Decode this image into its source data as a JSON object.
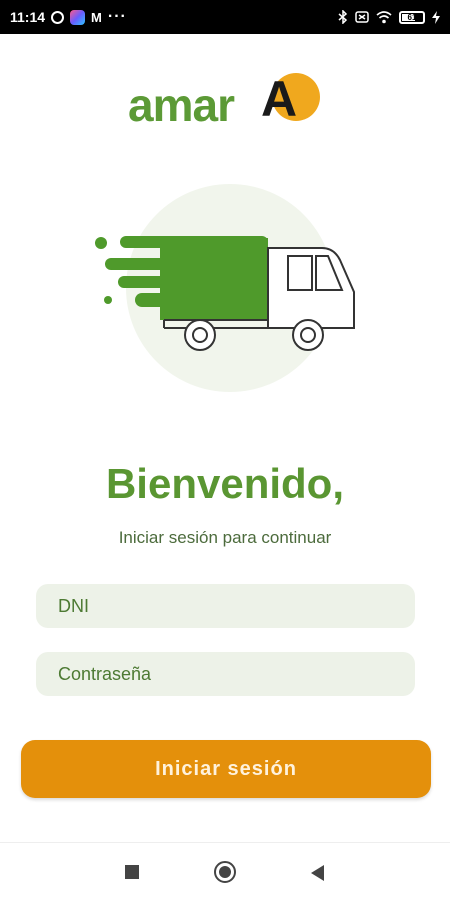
{
  "status_bar": {
    "time": "11:14",
    "battery": "61"
  },
  "logo": {
    "text": "amar",
    "accent_letter": "A",
    "brand_green": "#5c9a36",
    "brand_orange": "#f0a81e"
  },
  "illustration": {
    "icon": "delivery-truck-icon"
  },
  "welcome": {
    "title": "Bienvenido,",
    "subtitle": "Iniciar sesión para continuar"
  },
  "form": {
    "dni_placeholder": "DNI",
    "password_placeholder": "Contraseña",
    "submit_label": "Iniciar sesión",
    "submit_color": "#e4900b"
  },
  "nav": {
    "recents": "square-icon",
    "home": "circle-icon",
    "back": "triangle-back-icon"
  }
}
